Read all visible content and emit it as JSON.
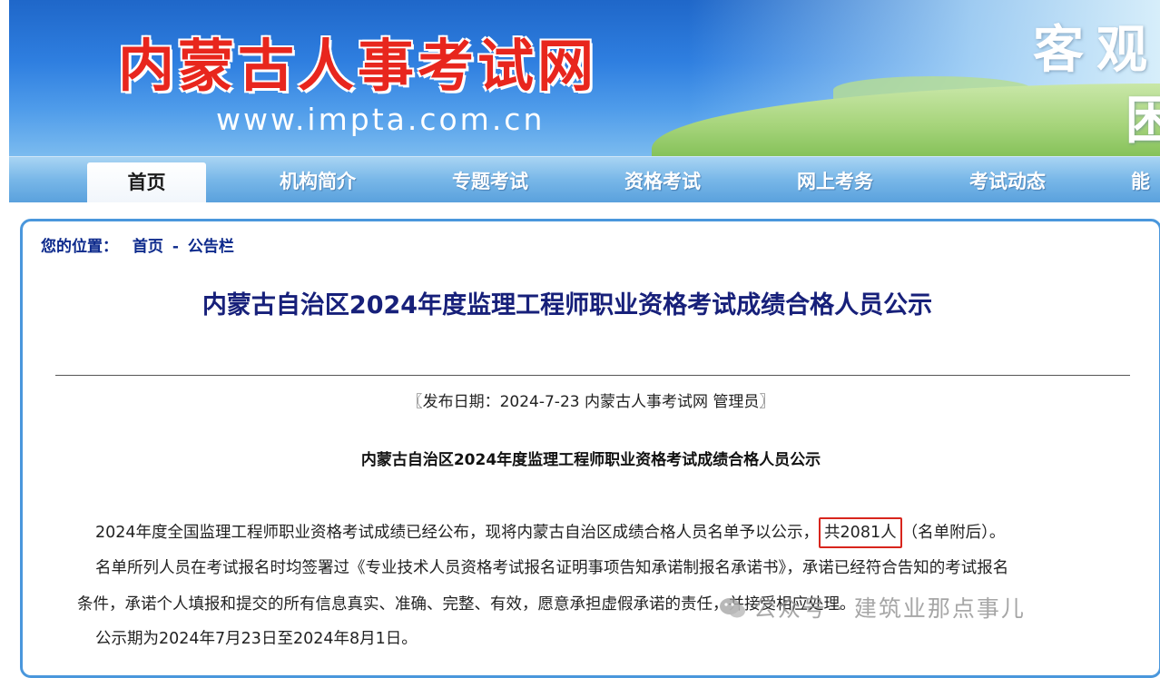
{
  "banner": {
    "site_title": "内蒙古人事考试网",
    "site_url": "www.impta.com.cn",
    "slogan": "客观",
    "slogan_line2": "困"
  },
  "nav": {
    "items": [
      {
        "label": "首页",
        "active": true
      },
      {
        "label": "机构简介",
        "active": false
      },
      {
        "label": "专题考试",
        "active": false
      },
      {
        "label": "资格考试",
        "active": false
      },
      {
        "label": "网上考务",
        "active": false
      },
      {
        "label": "考试动态",
        "active": false
      },
      {
        "label": "能",
        "active": false
      }
    ]
  },
  "breadcrumb": {
    "prefix": "您的位置：",
    "home": "首页",
    "separator": "-",
    "current": "公告栏"
  },
  "article": {
    "title": "内蒙古自治区2024年度监理工程师职业资格考试成绩合格人员公示",
    "meta": "〖发布日期：2024-7-23 内蒙古人事考试网 管理员〗",
    "subtitle": "内蒙古自治区2024年度监理工程师职业资格考试成绩合格人员公示",
    "p1_before": "2024年度全国监理工程师职业资格考试成绩已经公布，现将内蒙古自治区成绩合格人员名单予以公示，",
    "p1_count": "共2081人",
    "p1_after": "（名单附后）。",
    "p2": "名单所列人员在考试报名时均签署过《专业技术人员资格考试报名证明事项告知承诺制报名承诺书》，承诺已经符合告知的考试报名",
    "p3": "条件，承诺个人填报和提交的所有信息真实、准确、完整、有效，愿意承担虚假承诺的责任，并接受相应处理。",
    "p4": "公示期为2024年7月23日至2024年8月1日。"
  },
  "watermark": {
    "text": "公众号 · 建筑业那点事儿",
    "icon": "wechat-icon"
  },
  "colors": {
    "banner_blue": "#2f7fe0",
    "title_red": "#e8261d",
    "nav_blue": "#78b7e8",
    "heading_navy": "#17207a",
    "highlight_red": "#d8251d",
    "border_blue": "#4a97dc"
  }
}
